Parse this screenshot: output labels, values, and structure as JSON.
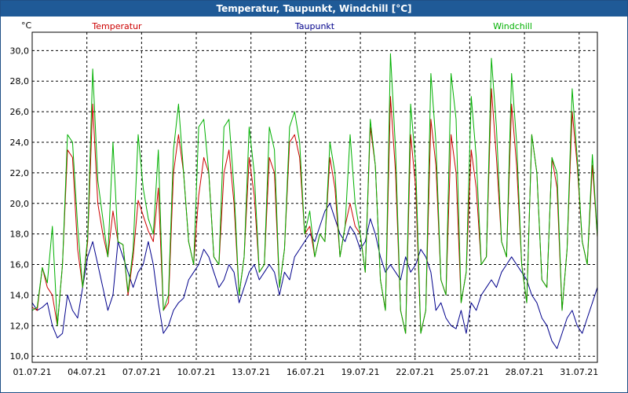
{
  "window": {
    "title": "Temperatur, Taupunkt, Windchill [°C]"
  },
  "chart_data": {
    "type": "line",
    "title": "Temperatur, Taupunkt, Windchill [°C]",
    "ylabel": "°C",
    "xlabel": "",
    "ylim": [
      9.6,
      31.2
    ],
    "xlim": [
      "01.07.21",
      "31.07.21 +1d"
    ],
    "grid": true,
    "legend_position": "top",
    "y_ticks": [
      "10,0",
      "12,0",
      "14,0",
      "16,0",
      "18,0",
      "20,0",
      "22,0",
      "24,0",
      "26,0",
      "28,0",
      "30,0"
    ],
    "x_ticks": [
      "01.07.21",
      "04.07.21",
      "07.07.21",
      "10.07.21",
      "13.07.21",
      "16.07.21",
      "19.07.21",
      "22.07.21",
      "25.07.21",
      "28.07.21",
      "31.07.21"
    ],
    "colors": {
      "Temperatur": "#cc0000",
      "Taupunkt": "#00008b",
      "Windchill": "#00b000"
    },
    "series": [
      {
        "name": "Temperatur",
        "values": [
          13.2,
          13.0,
          15.8,
          14.5,
          14.0,
          12.0,
          16.0,
          23.5,
          23.0,
          17.0,
          14.5,
          17.5,
          26.5,
          20.0,
          18.0,
          16.5,
          19.5,
          17.5,
          17.3,
          14.0,
          16.5,
          20.2,
          19.2,
          18.2,
          17.5,
          21.0,
          13.0,
          13.5,
          22.0,
          24.5,
          22.0,
          17.5,
          16.0,
          20.5,
          23.0,
          22.0,
          16.5,
          16.0,
          22.0,
          23.5,
          20.0,
          14.0,
          16.5,
          23.0,
          20.5,
          15.5,
          16.0,
          23.0,
          22.0,
          14.5,
          17.0,
          24.0,
          24.5,
          23.0,
          18.0,
          18.5,
          16.5,
          18.0,
          17.5,
          23.0,
          21.0,
          16.5,
          18.5,
          20.0,
          18.5,
          18.0,
          15.5,
          25.0,
          22.5,
          15.0,
          13.0,
          27.0,
          22.0,
          13.0,
          11.5,
          24.5,
          21.0,
          11.5,
          13.0,
          25.5,
          22.5,
          15.0,
          14.0,
          24.5,
          22.0,
          13.5,
          15.5,
          23.5,
          21.0,
          16.0,
          16.5,
          27.5,
          23.0,
          17.5,
          16.5,
          26.5,
          22.5,
          16.0,
          13.5,
          24.5,
          22.0,
          15.0,
          14.5,
          23.0,
          21.0,
          13.0,
          17.0,
          26.0,
          22.5,
          17.5,
          16.0,
          22.5,
          17.8
        ]
      },
      {
        "name": "Taupunkt",
        "values": [
          13.5,
          13.0,
          13.2,
          13.5,
          12.0,
          11.2,
          11.5,
          14.0,
          13.0,
          12.5,
          14.5,
          16.5,
          17.5,
          16.0,
          14.5,
          13.0,
          14.0,
          17.5,
          16.5,
          15.5,
          14.5,
          15.5,
          16.0,
          17.5,
          16.0,
          13.5,
          11.5,
          12.0,
          13.0,
          13.5,
          13.8,
          15.0,
          15.5,
          16.0,
          17.0,
          16.5,
          15.5,
          14.5,
          15.0,
          16.0,
          15.5,
          13.5,
          14.5,
          15.5,
          16.0,
          15.0,
          15.5,
          16.0,
          15.5,
          14.0,
          15.5,
          15.0,
          16.5,
          17.0,
          17.5,
          18.0,
          17.5,
          18.5,
          19.5,
          20.0,
          19.0,
          18.0,
          17.5,
          18.5,
          18.0,
          17.0,
          17.5,
          19.0,
          18.0,
          16.5,
          15.5,
          16.0,
          15.5,
          15.0,
          16.5,
          15.5,
          16.0,
          17.0,
          16.5,
          15.5,
          13.0,
          13.5,
          12.5,
          12.0,
          11.8,
          13.0,
          11.5,
          13.5,
          13.0,
          14.0,
          14.5,
          15.0,
          14.5,
          15.5,
          16.0,
          16.5,
          16.0,
          15.5,
          15.0,
          14.0,
          13.5,
          12.5,
          12.0,
          11.0,
          10.5,
          11.5,
          12.5,
          13.0,
          12.0,
          11.5,
          12.5,
          13.5,
          14.5
        ]
      },
      {
        "name": "Windchill",
        "values": [
          13.0,
          13.2,
          15.8,
          14.8,
          18.5,
          12.0,
          16.0,
          24.5,
          24.0,
          18.5,
          14.5,
          17.8,
          28.8,
          21.5,
          19.0,
          16.5,
          24.0,
          17.5,
          17.3,
          14.2,
          17.0,
          24.5,
          21.0,
          19.0,
          18.0,
          23.5,
          13.0,
          14.0,
          23.5,
          26.5,
          22.0,
          17.5,
          16.0,
          25.0,
          25.5,
          22.0,
          16.5,
          16.0,
          25.0,
          25.5,
          21.0,
          14.0,
          16.5,
          25.0,
          22.0,
          15.5,
          16.0,
          25.0,
          23.5,
          14.5,
          17.0,
          25.0,
          26.0,
          24.0,
          18.0,
          19.5,
          16.5,
          18.0,
          17.5,
          24.0,
          22.0,
          16.5,
          18.5,
          24.5,
          20.0,
          18.0,
          15.5,
          25.5,
          22.5,
          15.0,
          13.0,
          29.8,
          23.5,
          13.0,
          11.5,
          26.5,
          22.5,
          11.5,
          13.0,
          28.5,
          24.0,
          15.0,
          14.0,
          28.5,
          25.5,
          13.5,
          15.5,
          27.0,
          23.0,
          16.0,
          16.5,
          29.5,
          25.0,
          17.5,
          16.5,
          28.5,
          24.0,
          16.0,
          13.5,
          24.5,
          22.0,
          15.0,
          14.5,
          23.0,
          22.0,
          13.0,
          17.0,
          27.5,
          23.0,
          17.5,
          16.0,
          23.2,
          17.8
        ]
      }
    ]
  }
}
